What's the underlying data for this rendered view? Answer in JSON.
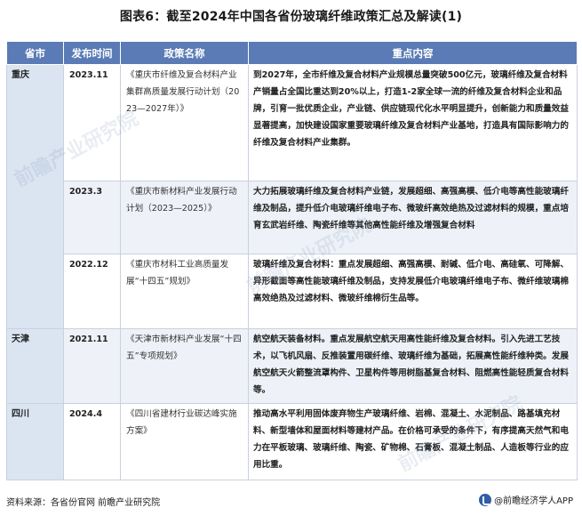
{
  "title": "图表6：截至2024年中国各省份玻璃纤维政策汇总及解读(1)",
  "table": {
    "headers": [
      "省市",
      "发布时间",
      "政策名称",
      "重点内容"
    ],
    "rows": [
      {
        "province": "重庆",
        "date": "2023.11",
        "name": "《重庆市纤维及复合材料产业集群高质量发展行动计划（2023—2027年）》",
        "content": "到2027年，全市纤维及复合材料产业规模总量突破500亿元，玻璃纤维及复合材料产销量占全国比重达到20%以上，打造1-2家全球一流的纤维及复合材料企业和品牌，引育一批优质企业，产业链、供应链现代化水平明显提升，创新能力和质量效益显著提高，加快建设国家重要玻璃纤维及复合材料产业基地，打造具有国际影响力的纤维及复合材料产业集群。"
      },
      {
        "province": "",
        "date": "2023.3",
        "name": "《重庆市新材料产业发展行动计划（2023—2025）》",
        "content": "大力拓展玻璃纤维及复合材料产业链，发展超细、高强高模、低介电等高性能玻璃纤维及制品，提升低介电玻璃纤维电子布、微玻纤高效绝热及过滤材料的规模，重点培育玄武岩纤维、陶瓷纤维等其他高性能纤维及增强复合材料"
      },
      {
        "province": "",
        "date": "2022.12",
        "name": "《重庆市材料工业高质量发展“十四五”规划》",
        "content": "玻璃纤维及复合材料：重点发展超细、高强高模、耐碱、低介电、高硅氧、可降解、异形截面等高性能玻璃纤维及制品，支持发展低介电玻璃纤维电子布、微纤维玻璃棉高效绝热及过滤材料、微玻纤维棉衍生品等。"
      },
      {
        "province": "天津",
        "date": "2021.11",
        "name": "《天津市新材料产业发展“十四五”专项规划》",
        "content": "航空航天装备材料。重点发展航空航天用高性能纤维及复合材料。引入先进工艺技术，以飞机风扇、反推装置用碳纤维、玻璃纤维为基础，拓展高性能纤维种类。发展航空航天火箭整流罩构件、卫星构件等用树脂基复合材料、阻燃高性能轻质复合材料等。"
      },
      {
        "province": "四川",
        "date": "2024.4",
        "name": "《四川省建材行业碳达峰实施方案》",
        "content": "推动高水平利用固体废弃物生产玻璃纤维、岩棉、混凝土、水泥制品、路基填充材料、新型墙体和屋面材料等建材产品。在价格可承受的条件下，有序提高天然气和电力在平板玻璃、玻璃纤维、陶瓷、矿物棉、石膏板、混凝土制品、人造板等行业的应用比重。"
      }
    ]
  },
  "footer": {
    "source": "资料来源：各省份官网 前瞻产业研究院",
    "brand": "@前瞻经济学人APP",
    "brand_icon": "qianzhan-logo-icon"
  },
  "watermark": "前瞻产业研究院",
  "colors": {
    "header_bg": "#5a7bb5",
    "province_bg": "#dbe4f1",
    "alt_row_bg": "#eef2f8"
  }
}
